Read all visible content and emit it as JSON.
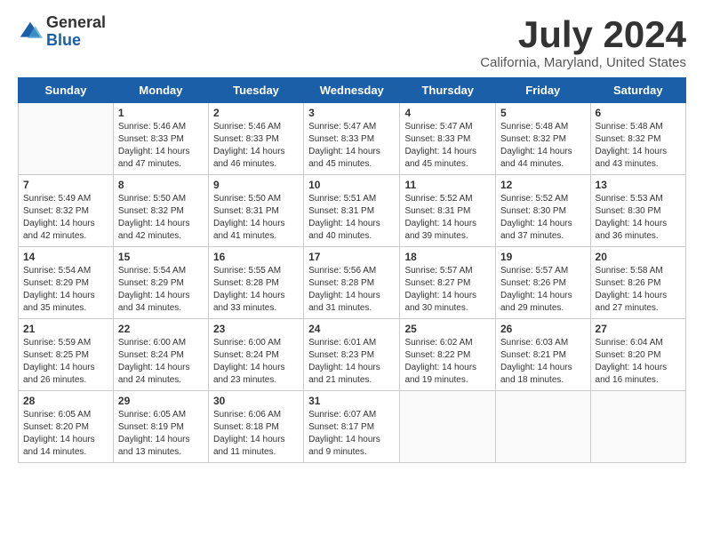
{
  "logo": {
    "general": "General",
    "blue": "Blue"
  },
  "title": "July 2024",
  "subtitle": "California, Maryland, United States",
  "days_of_week": [
    "Sunday",
    "Monday",
    "Tuesday",
    "Wednesday",
    "Thursday",
    "Friday",
    "Saturday"
  ],
  "weeks": [
    [
      {
        "day": "",
        "sunrise": "",
        "sunset": "",
        "daylight": ""
      },
      {
        "day": "1",
        "sunrise": "Sunrise: 5:46 AM",
        "sunset": "Sunset: 8:33 PM",
        "daylight": "Daylight: 14 hours and 47 minutes."
      },
      {
        "day": "2",
        "sunrise": "Sunrise: 5:46 AM",
        "sunset": "Sunset: 8:33 PM",
        "daylight": "Daylight: 14 hours and 46 minutes."
      },
      {
        "day": "3",
        "sunrise": "Sunrise: 5:47 AM",
        "sunset": "Sunset: 8:33 PM",
        "daylight": "Daylight: 14 hours and 45 minutes."
      },
      {
        "day": "4",
        "sunrise": "Sunrise: 5:47 AM",
        "sunset": "Sunset: 8:33 PM",
        "daylight": "Daylight: 14 hours and 45 minutes."
      },
      {
        "day": "5",
        "sunrise": "Sunrise: 5:48 AM",
        "sunset": "Sunset: 8:32 PM",
        "daylight": "Daylight: 14 hours and 44 minutes."
      },
      {
        "day": "6",
        "sunrise": "Sunrise: 5:48 AM",
        "sunset": "Sunset: 8:32 PM",
        "daylight": "Daylight: 14 hours and 43 minutes."
      }
    ],
    [
      {
        "day": "7",
        "sunrise": "Sunrise: 5:49 AM",
        "sunset": "Sunset: 8:32 PM",
        "daylight": "Daylight: 14 hours and 42 minutes."
      },
      {
        "day": "8",
        "sunrise": "Sunrise: 5:50 AM",
        "sunset": "Sunset: 8:32 PM",
        "daylight": "Daylight: 14 hours and 42 minutes."
      },
      {
        "day": "9",
        "sunrise": "Sunrise: 5:50 AM",
        "sunset": "Sunset: 8:31 PM",
        "daylight": "Daylight: 14 hours and 41 minutes."
      },
      {
        "day": "10",
        "sunrise": "Sunrise: 5:51 AM",
        "sunset": "Sunset: 8:31 PM",
        "daylight": "Daylight: 14 hours and 40 minutes."
      },
      {
        "day": "11",
        "sunrise": "Sunrise: 5:52 AM",
        "sunset": "Sunset: 8:31 PM",
        "daylight": "Daylight: 14 hours and 39 minutes."
      },
      {
        "day": "12",
        "sunrise": "Sunrise: 5:52 AM",
        "sunset": "Sunset: 8:30 PM",
        "daylight": "Daylight: 14 hours and 37 minutes."
      },
      {
        "day": "13",
        "sunrise": "Sunrise: 5:53 AM",
        "sunset": "Sunset: 8:30 PM",
        "daylight": "Daylight: 14 hours and 36 minutes."
      }
    ],
    [
      {
        "day": "14",
        "sunrise": "Sunrise: 5:54 AM",
        "sunset": "Sunset: 8:29 PM",
        "daylight": "Daylight: 14 hours and 35 minutes."
      },
      {
        "day": "15",
        "sunrise": "Sunrise: 5:54 AM",
        "sunset": "Sunset: 8:29 PM",
        "daylight": "Daylight: 14 hours and 34 minutes."
      },
      {
        "day": "16",
        "sunrise": "Sunrise: 5:55 AM",
        "sunset": "Sunset: 8:28 PM",
        "daylight": "Daylight: 14 hours and 33 minutes."
      },
      {
        "day": "17",
        "sunrise": "Sunrise: 5:56 AM",
        "sunset": "Sunset: 8:28 PM",
        "daylight": "Daylight: 14 hours and 31 minutes."
      },
      {
        "day": "18",
        "sunrise": "Sunrise: 5:57 AM",
        "sunset": "Sunset: 8:27 PM",
        "daylight": "Daylight: 14 hours and 30 minutes."
      },
      {
        "day": "19",
        "sunrise": "Sunrise: 5:57 AM",
        "sunset": "Sunset: 8:26 PM",
        "daylight": "Daylight: 14 hours and 29 minutes."
      },
      {
        "day": "20",
        "sunrise": "Sunrise: 5:58 AM",
        "sunset": "Sunset: 8:26 PM",
        "daylight": "Daylight: 14 hours and 27 minutes."
      }
    ],
    [
      {
        "day": "21",
        "sunrise": "Sunrise: 5:59 AM",
        "sunset": "Sunset: 8:25 PM",
        "daylight": "Daylight: 14 hours and 26 minutes."
      },
      {
        "day": "22",
        "sunrise": "Sunrise: 6:00 AM",
        "sunset": "Sunset: 8:24 PM",
        "daylight": "Daylight: 14 hours and 24 minutes."
      },
      {
        "day": "23",
        "sunrise": "Sunrise: 6:00 AM",
        "sunset": "Sunset: 8:24 PM",
        "daylight": "Daylight: 14 hours and 23 minutes."
      },
      {
        "day": "24",
        "sunrise": "Sunrise: 6:01 AM",
        "sunset": "Sunset: 8:23 PM",
        "daylight": "Daylight: 14 hours and 21 minutes."
      },
      {
        "day": "25",
        "sunrise": "Sunrise: 6:02 AM",
        "sunset": "Sunset: 8:22 PM",
        "daylight": "Daylight: 14 hours and 19 minutes."
      },
      {
        "day": "26",
        "sunrise": "Sunrise: 6:03 AM",
        "sunset": "Sunset: 8:21 PM",
        "daylight": "Daylight: 14 hours and 18 minutes."
      },
      {
        "day": "27",
        "sunrise": "Sunrise: 6:04 AM",
        "sunset": "Sunset: 8:20 PM",
        "daylight": "Daylight: 14 hours and 16 minutes."
      }
    ],
    [
      {
        "day": "28",
        "sunrise": "Sunrise: 6:05 AM",
        "sunset": "Sunset: 8:20 PM",
        "daylight": "Daylight: 14 hours and 14 minutes."
      },
      {
        "day": "29",
        "sunrise": "Sunrise: 6:05 AM",
        "sunset": "Sunset: 8:19 PM",
        "daylight": "Daylight: 14 hours and 13 minutes."
      },
      {
        "day": "30",
        "sunrise": "Sunrise: 6:06 AM",
        "sunset": "Sunset: 8:18 PM",
        "daylight": "Daylight: 14 hours and 11 minutes."
      },
      {
        "day": "31",
        "sunrise": "Sunrise: 6:07 AM",
        "sunset": "Sunset: 8:17 PM",
        "daylight": "Daylight: 14 hours and 9 minutes."
      },
      {
        "day": "",
        "sunrise": "",
        "sunset": "",
        "daylight": ""
      },
      {
        "day": "",
        "sunrise": "",
        "sunset": "",
        "daylight": ""
      },
      {
        "day": "",
        "sunrise": "",
        "sunset": "",
        "daylight": ""
      }
    ]
  ]
}
